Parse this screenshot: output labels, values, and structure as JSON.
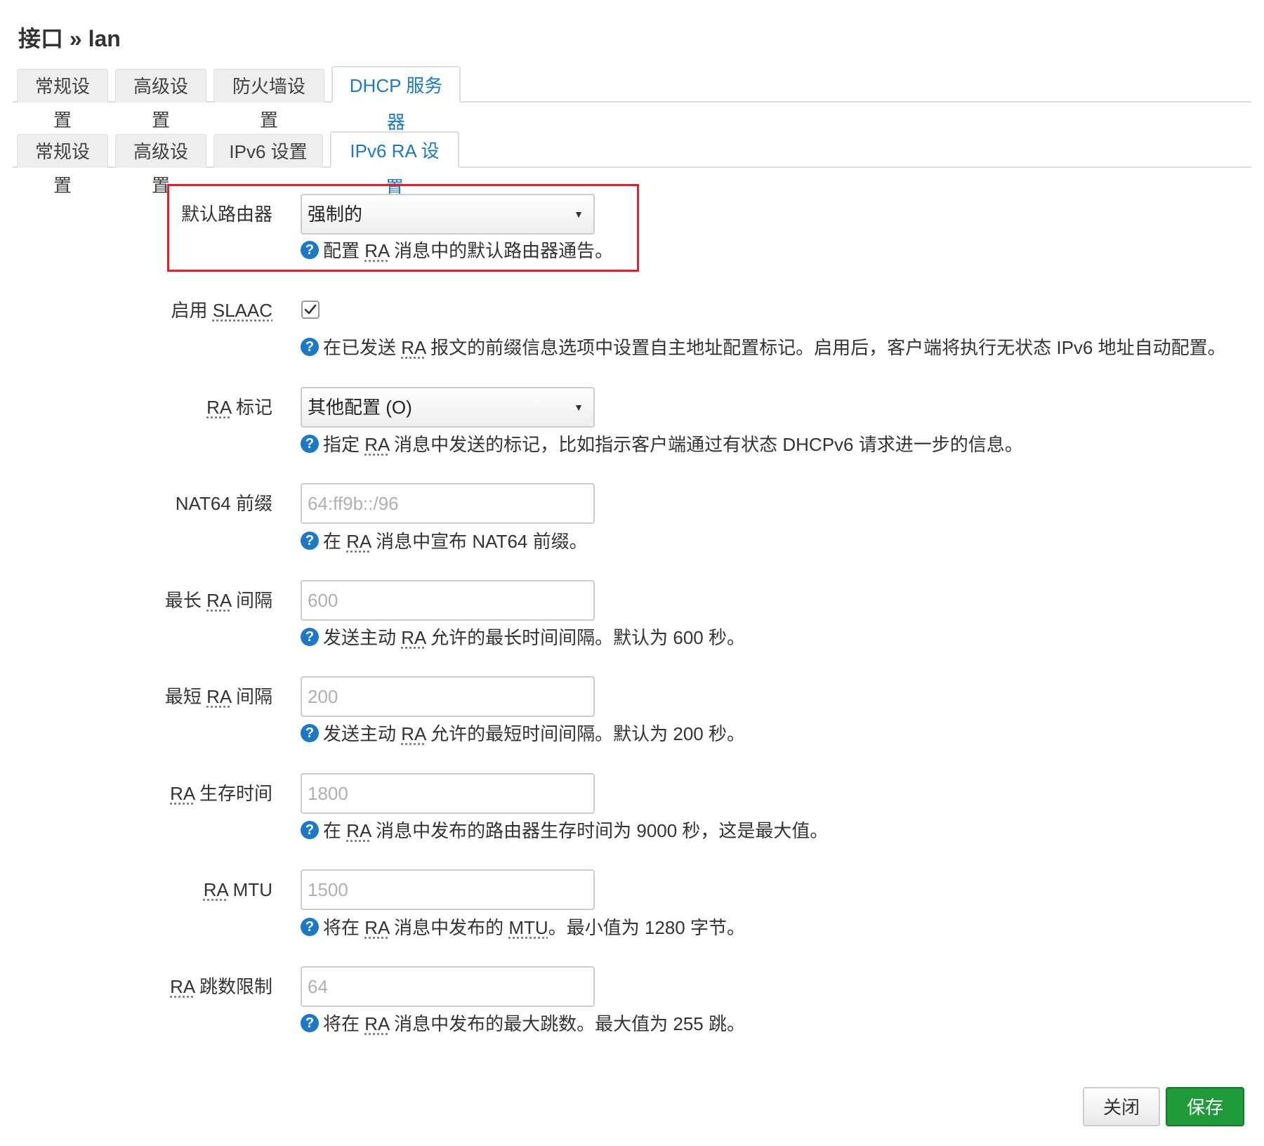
{
  "page": {
    "title": "接口 » lan"
  },
  "main_tabs": [
    {
      "label": "常规设置"
    },
    {
      "label": "高级设置"
    },
    {
      "label": "防火墙设置"
    },
    {
      "label": "DHCP 服务器"
    }
  ],
  "sub_tabs": [
    {
      "label": "常规设置"
    },
    {
      "label": "高级设置"
    },
    {
      "label": "IPv6 设置"
    },
    {
      "label": "IPv6 RA 设置"
    }
  ],
  "active_main_tab": "DHCP 服务器",
  "active_sub_tab": "IPv6 RA 设置",
  "help_icon": "question-circle-icon",
  "fields": {
    "default_router": {
      "label": "默认路由器",
      "value": "强制的",
      "help_pre": "配置 ",
      "help_abbr": "RA",
      "help_post": " 消息中的默认路由器通告。"
    },
    "slaac": {
      "label_pre": "启用 ",
      "label_abbr": "SLAAC",
      "checked": true,
      "help_pre": "在已发送 ",
      "help_abbr": "RA",
      "help_post": " 报文的前缀信息选项中设置自主地址配置标记。启用后，客户端将执行无状态 IPv6 地址自动配置。"
    },
    "ra_flags": {
      "label_abbr": "RA",
      "label_post": " 标记",
      "value": "其他配置 (O)",
      "help_pre": "指定 ",
      "help_abbr": "RA",
      "help_post": " 消息中发送的标记，比如指示客户端通过有状态 DHCPv6 请求进一步的信息。"
    },
    "nat64": {
      "label": "NAT64 前缀",
      "placeholder": "64:ff9b::/96",
      "help_pre": "在 ",
      "help_abbr": "RA",
      "help_post": " 消息中宣布 NAT64 前缀。"
    },
    "max_interval": {
      "label_pre": "最长 ",
      "label_abbr": "RA",
      "label_post": " 间隔",
      "placeholder": "600",
      "help_pre": "发送主动 ",
      "help_abbr": "RA",
      "help_post": " 允许的最长时间间隔。默认为 600 秒。"
    },
    "min_interval": {
      "label_pre": "最短 ",
      "label_abbr": "RA",
      "label_post": " 间隔",
      "placeholder": "200",
      "help_pre": "发送主动 ",
      "help_abbr": "RA",
      "help_post": " 允许的最短时间间隔。默认为 200 秒。"
    },
    "lifetime": {
      "label_abbr": "RA",
      "label_post": " 生存时间",
      "placeholder": "1800",
      "help_pre": "在 ",
      "help_abbr": "RA",
      "help_post": " 消息中发布的路由器生存时间为 9000 秒，这是最大值。"
    },
    "mtu": {
      "label_abbr": "RA",
      "label_post": " MTU",
      "placeholder": "1500",
      "help_pre": "将在 ",
      "help_abbr": "RA",
      "help_mid": " 消息中发布的 ",
      "help_abbr2": "MTU",
      "help_post": "。最小值为 1280 字节。"
    },
    "hoplimit": {
      "label_abbr": "RA",
      "label_post": " 跳数限制",
      "placeholder": "64",
      "help_pre": "将在 ",
      "help_abbr": "RA",
      "help_post": " 消息中发布的最大跳数。最大值为 255 跳。"
    }
  },
  "buttons": {
    "close": "关闭",
    "save": "保存"
  },
  "colors": {
    "accent": "#1d78c6",
    "save": "#1f9b3c",
    "highlight": "#e0202a"
  }
}
